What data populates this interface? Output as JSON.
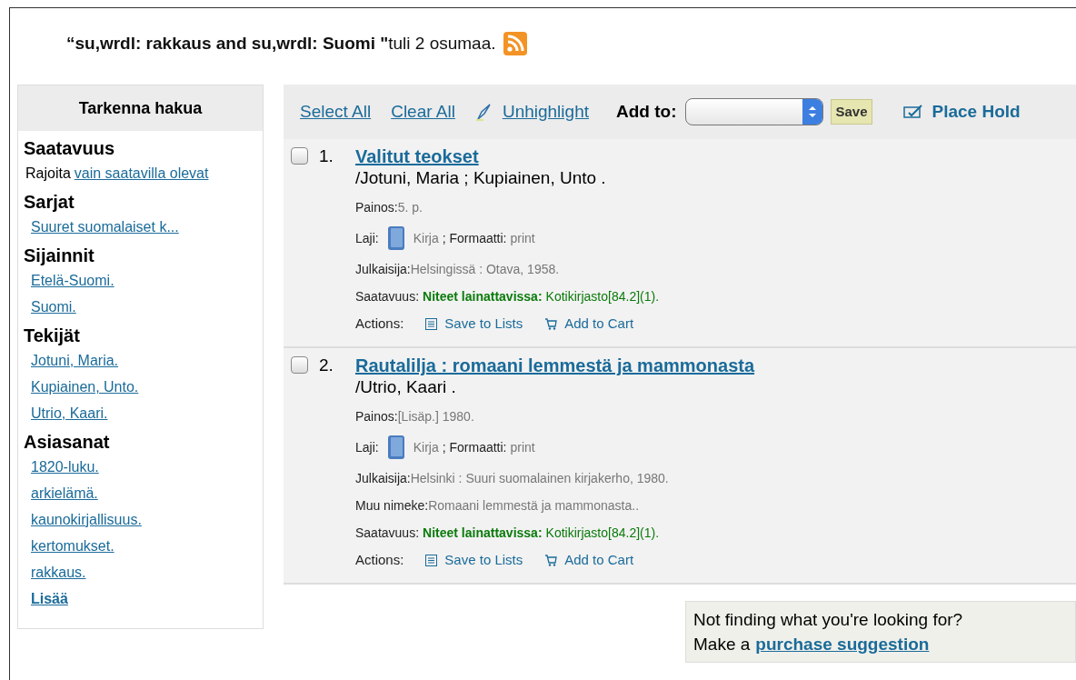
{
  "header": {
    "text": "**“su,wrdl: rakkaus and su,wrdl: Suomi \"**tuli 2 osumaa."
  },
  "sidebar": {
    "title": "Tarkenna hakua",
    "sections": [
      {
        "title": "Saatavuus",
        "items": [
          {
            "kind": "limit",
            "prefix": "Rajoita",
            "text": "vain saatavilla olevat"
          }
        ]
      },
      {
        "title": "Sarjat",
        "items": [
          {
            "kind": "link",
            "text": "Suuret suomalaiset k..."
          }
        ]
      },
      {
        "title": "Sijainnit",
        "items": [
          {
            "kind": "link",
            "text": "Etelä-Suomi."
          },
          {
            "kind": "link",
            "text": "Suomi."
          }
        ]
      },
      {
        "title": "Tekijät",
        "items": [
          {
            "kind": "link",
            "text": "Jotuni, Maria."
          },
          {
            "kind": "link",
            "text": "Kupiainen, Unto."
          },
          {
            "kind": "link",
            "text": "Utrio, Kaari."
          }
        ]
      },
      {
        "title": "Asiasanat",
        "items": [
          {
            "kind": "link",
            "text": "1820-luku."
          },
          {
            "kind": "link",
            "text": "arkielämä."
          },
          {
            "kind": "link",
            "text": "kaunokirjallisuus."
          },
          {
            "kind": "link",
            "text": "kertomukset."
          },
          {
            "kind": "link",
            "text": "rakkaus."
          },
          {
            "kind": "more",
            "text": "Lisää"
          }
        ]
      }
    ]
  },
  "toolbar": {
    "select_all": "Select All",
    "clear_all": "Clear All",
    "unhighlight": "Unhighlight",
    "add_to_label": "Add to:",
    "save": "Save",
    "place_hold": "Place Hold"
  },
  "results": [
    {
      "checked": false,
      "number": "1.",
      "title": "Valitut teokset",
      "author": "/Jotuni, Maria ; Kupiainen, Unto .",
      "fields": [
        {
          "kind": "plain",
          "label": "Painos:",
          "value": "5. p."
        },
        {
          "kind": "type",
          "label": "Laji:",
          "value": "Kirja",
          "format_label": "; Formaatti:",
          "format_value": "print"
        },
        {
          "kind": "plain",
          "label": "Julkaisija:",
          "value": "Helsingissä : Otava, 1958."
        },
        {
          "kind": "availability",
          "label": "Saatavuus:",
          "status": "Niteet lainattavissa:",
          "value": "Kotikirjasto[84.2](1)."
        },
        {
          "kind": "actions",
          "label": "Actions:",
          "save": "Save to Lists",
          "cart": "Add to Cart"
        }
      ]
    },
    {
      "checked": false,
      "number": "2.",
      "title": "Rautalilja : romaani lemmestä ja mammonasta",
      "author": "/Utrio, Kaari .",
      "fields": [
        {
          "kind": "plain",
          "label": "Painos:",
          "value": "[Lisäp.] 1980."
        },
        {
          "kind": "type",
          "label": "Laji:",
          "value": "Kirja",
          "format_label": "; Formaatti:",
          "format_value": "print"
        },
        {
          "kind": "plain",
          "label": "Julkaisija:",
          "value": "Helsinki : Suuri suomalainen kirjakerho, 1980."
        },
        {
          "kind": "plain",
          "label": "Muu nimeke:",
          "value": "Romaani lemmestä ja mammonasta.."
        },
        {
          "kind": "availability",
          "label": "Saatavuus:",
          "status": "Niteet lainattavissa:",
          "value": "Kotikirjasto[84.2](1)."
        },
        {
          "kind": "actions",
          "label": "Actions:",
          "save": "Save to Lists",
          "cart": "Add to Cart"
        }
      ]
    }
  ],
  "suggestion": {
    "text": "Not finding what you're looking for?",
    "prefix": "Make a",
    "link": "purchase suggestion"
  }
}
